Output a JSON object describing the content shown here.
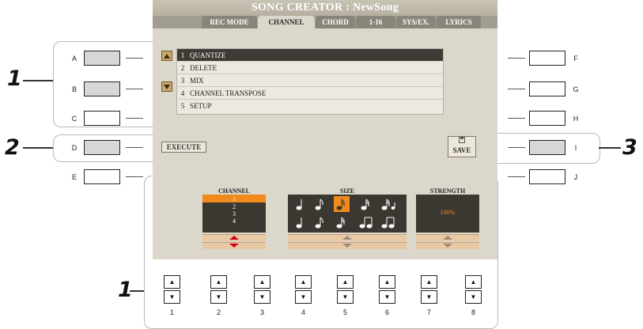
{
  "screen": {
    "title": "SONG CREATOR : NewSong",
    "tabs": [
      "REC MODE",
      "CHANNEL",
      "CHORD",
      "1-16",
      "SYS/EX.",
      "LYRICS"
    ],
    "active_tab": "CHANNEL",
    "menu": [
      {
        "num": "1",
        "label": "QUANTIZE"
      },
      {
        "num": "2",
        "label": "DELETE"
      },
      {
        "num": "3",
        "label": "MIX"
      },
      {
        "num": "4",
        "label": "CHANNEL TRANSPOSE"
      },
      {
        "num": "5",
        "label": "SETUP"
      }
    ],
    "execute_label": "EXECUTE",
    "save_label": "SAVE",
    "channel": {
      "heading": "CHANNEL",
      "values": [
        "1",
        "2",
        "3",
        "4"
      ]
    },
    "size": {
      "heading": "SIZE"
    },
    "strength": {
      "heading": "STRENGTH",
      "value": "100%"
    }
  },
  "side_buttons": {
    "left": [
      "A",
      "B",
      "C",
      "D",
      "E"
    ],
    "right": [
      "F",
      "G",
      "H",
      "I",
      "J"
    ]
  },
  "bottom_buttons": [
    "1",
    "2",
    "3",
    "4",
    "5",
    "6",
    "7",
    "8"
  ],
  "callouts": {
    "menu": "1",
    "execute": "2",
    "save": "3",
    "bottom": "1"
  },
  "colors": {
    "lcd_bg": "#dcd7cb",
    "highlight": "#f08a1c",
    "dark": "#3b3731"
  }
}
